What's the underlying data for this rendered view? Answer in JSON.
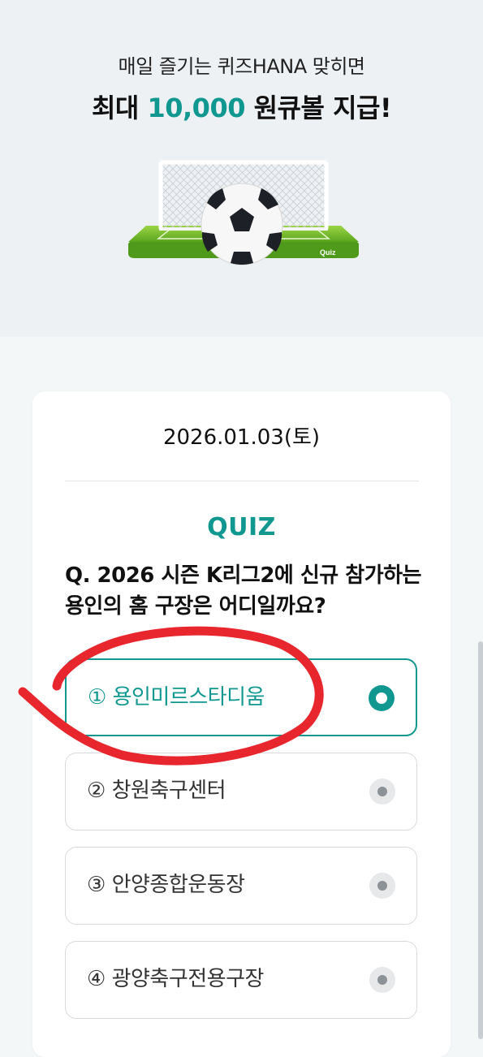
{
  "hero": {
    "line1": "매일 즐기는 퀴즈HANA 맞히면",
    "line2_prefix": "최대 ",
    "line2_amount": "10,000",
    "line2_suffix": " 원큐볼 지급!",
    "illustration_label": "Quiz"
  },
  "quiz": {
    "date": "2026.01.03(토)",
    "label": "QUIZ",
    "question": "Q. 2026 시즌 K리그2에 신규 참가하는 용인의 홈 구장은 어디일까요?",
    "options": [
      {
        "label": "① 용인미르스타디움",
        "selected": true
      },
      {
        "label": "② 창원축구센터",
        "selected": false
      },
      {
        "label": "③ 안양종합운동장",
        "selected": false
      },
      {
        "label": "④ 광양축구전용구장",
        "selected": false
      }
    ]
  },
  "colors": {
    "accent": "#109890",
    "annotation": "#e8262d"
  }
}
